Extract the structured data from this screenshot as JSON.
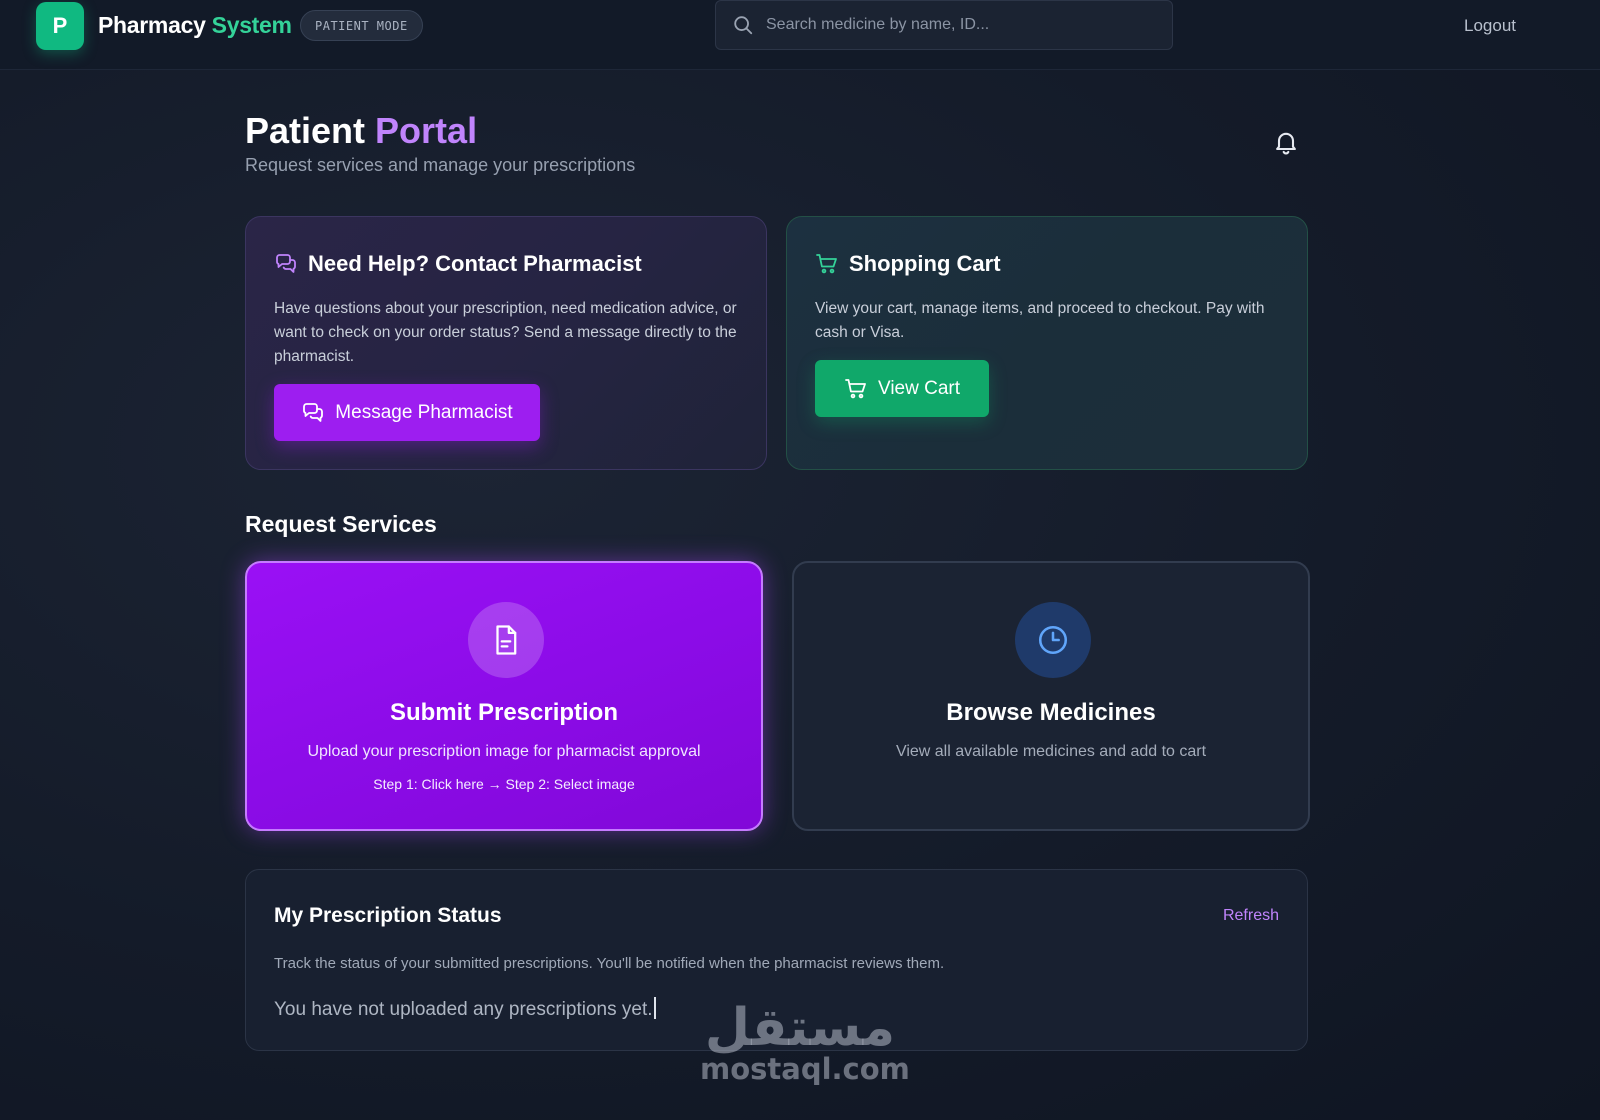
{
  "app": {
    "logo_letter": "P",
    "brand_main": "Pharmacy",
    "brand_accent": "System",
    "mode": "PATIENT MODE",
    "brand_color": "#10b981",
    "accent_color": "#c084fc"
  },
  "search": {
    "placeholder": "Search medicine by name, ID...",
    "icon": "search-icon"
  },
  "header": {
    "logout_label": "Logout",
    "title_main": "Patient",
    "title_accent": "Portal",
    "subtitle": "Request services and manage your prescriptions",
    "notification_icon": "bell-icon"
  },
  "help_card": {
    "icon": "chat-bubbles-icon",
    "title": "Need Help? Contact Pharmacist",
    "text": "Have questions about your prescription, need medication advice, or want to check on your order status? Send a message directly to the pharmacist.",
    "button_label": "Message Pharmacist",
    "button_color": "#9d1ef0"
  },
  "cart_card": {
    "icon": "cart-icon",
    "title": "Shopping Cart",
    "text": "View your cart, manage items, and proceed to checkout. Pay with cash or Visa.",
    "button_label": "View Cart",
    "button_color": "#10a86a"
  },
  "services": {
    "section_title": "Request Services",
    "items": [
      {
        "icon": "document-icon",
        "title": "Submit Prescription",
        "description": "Upload your prescription image for pharmacist approval",
        "steps": "Step 1: Click here → Step 2: Select image"
      },
      {
        "icon": "clock-icon",
        "title": "Browse Medicines",
        "description": "View all available medicines and add to cart"
      }
    ]
  },
  "status": {
    "title": "My Prescription Status",
    "refresh_label": "Refresh",
    "description": "Track the status of your submitted prescriptions. You'll be notified when the pharmacist reviews them.",
    "empty_message": "You have not uploaded any prescriptions yet."
  },
  "watermark": {
    "arabic": "مستقل",
    "latin": "mostaql.com"
  }
}
